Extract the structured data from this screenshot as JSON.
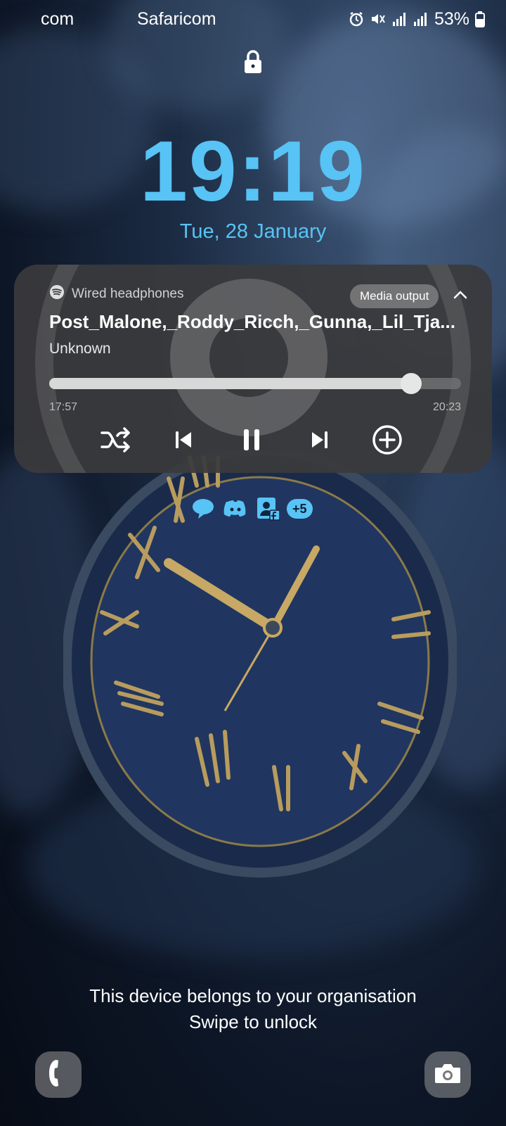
{
  "status_bar": {
    "carrier_1": "com",
    "carrier_2": "Safaricom",
    "battery_percent": "53%",
    "icons": [
      "alarm-icon",
      "mute-vibrate-icon",
      "signal-icon",
      "signal-icon",
      "battery-icon"
    ]
  },
  "lock_screen": {
    "time": "19:19",
    "date": "Tue, 28 January",
    "accent_color": "#58c3f5"
  },
  "media_player": {
    "app_icon": "spotify-icon",
    "output_device": "Wired headphones",
    "media_output_label": "Media output",
    "track_title": "Post_Malone,_Roddy_Ricch,_Gunna,_Lil_Tja...",
    "artist": "Unknown",
    "elapsed": "17:57",
    "duration": "20:23",
    "progress_fraction": 0.878,
    "controls": [
      "shuffle-icon",
      "previous-icon",
      "pause-icon",
      "next-icon",
      "add-icon"
    ]
  },
  "notifications": {
    "icons": [
      "chat-bubble-icon",
      "discord-icon",
      "facebook-contacts-icon"
    ],
    "more_count": "+5"
  },
  "footer": {
    "organisation_text": "This device belongs to your organisation",
    "unlock_hint": "Swipe to unlock",
    "left_shortcut": "phone-icon",
    "right_shortcut": "camera-icon"
  }
}
